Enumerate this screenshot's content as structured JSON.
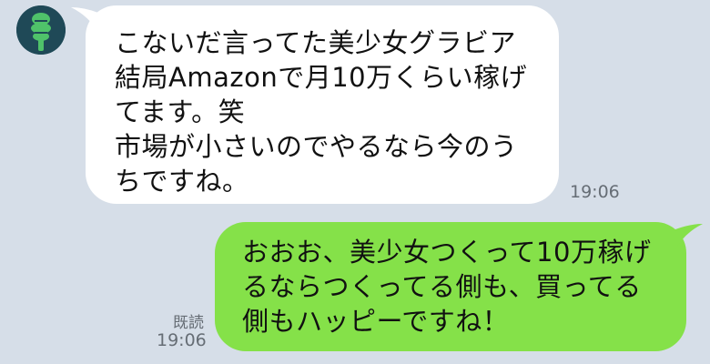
{
  "chat": {
    "incoming": {
      "avatar_icon": "green-character-avatar-icon",
      "text": "こないだ言ってた美少女グラビア\n結局Amazonで月10万くらい稼げ\nてます。笑\n市場が小さいのでやるなら今のう\nちですね。",
      "time": "19:06"
    },
    "outgoing": {
      "text": "おおお、美少女つくって10万稼げ\nるならつくってる側も、買ってる\n側もハッピーですね！",
      "read_status": "既読",
      "time": "19:06"
    }
  },
  "colors": {
    "background": "#d6dee8",
    "incoming_bubble": "#ffffff",
    "outgoing_bubble": "#85e149",
    "avatar_bg": "#1f4957",
    "avatar_figure": "#4fc26a",
    "meta_text": "#666d75"
  }
}
